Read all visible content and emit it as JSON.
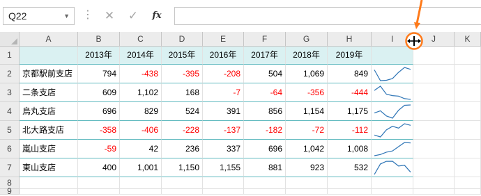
{
  "formula_bar": {
    "name_box": "Q22",
    "cancel_icon": "x-icon",
    "enter_icon": "check-icon",
    "function_label": "fx",
    "formula": ""
  },
  "columns": [
    "A",
    "B",
    "C",
    "D",
    "E",
    "F",
    "G",
    "H",
    "I",
    "J",
    "K"
  ],
  "rows": [
    "1",
    "2",
    "3",
    "4",
    "5",
    "6",
    "7",
    "8",
    "9"
  ],
  "header_row": [
    "2013年",
    "2014年",
    "2015年",
    "2016年",
    "2017年",
    "2018年",
    "2019年"
  ],
  "branches": [
    {
      "name": "京都駅前支店",
      "values": [
        "794",
        "-438",
        "-395",
        "-208",
        "504",
        "1,069",
        "849"
      ]
    },
    {
      "name": "二条支店",
      "values": [
        "609",
        "1,102",
        "168",
        "-7",
        "-64",
        "-356",
        "-444"
      ]
    },
    {
      "name": "烏丸支店",
      "values": [
        "696",
        "829",
        "524",
        "391",
        "856",
        "1,154",
        "1,175"
      ]
    },
    {
      "name": "北大路支店",
      "values": [
        "-358",
        "-406",
        "-228",
        "-137",
        "-182",
        "-72",
        "-112"
      ]
    },
    {
      "name": "嵐山支店",
      "values": [
        "-59",
        "42",
        "236",
        "337",
        "696",
        "1,042",
        "1,008"
      ]
    },
    {
      "name": "東山支店",
      "values": [
        "400",
        "1,001",
        "1,150",
        "1,155",
        "881",
        "923",
        "532"
      ]
    }
  ],
  "sparkline_data": [
    [
      794,
      -438,
      -395,
      -208,
      504,
      1069,
      849
    ],
    [
      609,
      1102,
      168,
      -7,
      -64,
      -356,
      -444
    ],
    [
      696,
      829,
      524,
      391,
      856,
      1154,
      1175
    ],
    [
      -358,
      -406,
      -228,
      -137,
      -182,
      -72,
      -112
    ],
    [
      -59,
      42,
      236,
      337,
      696,
      1042,
      1008
    ],
    [
      400,
      1001,
      1150,
      1155,
      881,
      923,
      532
    ]
  ],
  "colors": {
    "header_fill": "#daf1f2",
    "border_teal": "#5fb9bf",
    "negative_text": "#ff0000",
    "sparkline": "#2e75b6",
    "callout": "#ff7a1a"
  },
  "callout": {
    "icon": "column-resize-cursor-icon",
    "arrow": "arrow-pointer-icon"
  }
}
